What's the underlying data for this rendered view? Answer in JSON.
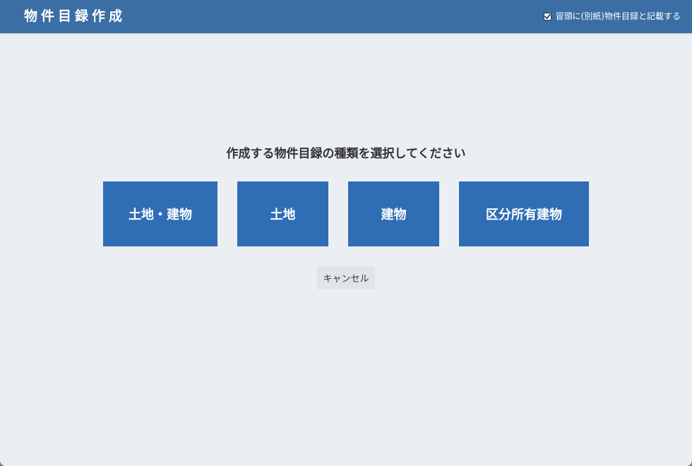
{
  "window": {
    "title": "物件目録作成"
  },
  "header_option": {
    "checked": true,
    "label": "冒頭に(別紙)物件目録と記載する"
  },
  "prompt": "作成する物件目録の種類を選択してください",
  "choices": [
    {
      "label": "土地・建物"
    },
    {
      "label": "土地"
    },
    {
      "label": "建物"
    },
    {
      "label": "区分所有建物"
    }
  ],
  "cancel_label": "キャンセル",
  "colors": {
    "titlebar": "#3a6ea5",
    "background": "#ebeff4",
    "choice_button": "#2f6db5",
    "cancel_button": "#e1e5eb",
    "text_dark": "#333333"
  }
}
